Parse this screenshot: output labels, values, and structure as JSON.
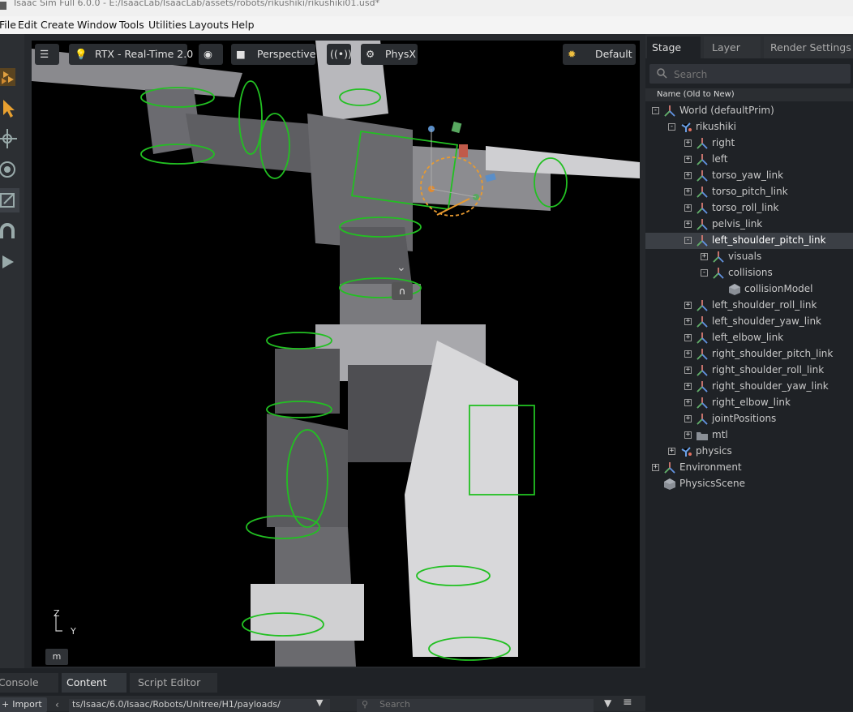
{
  "window": {
    "title": "Isaac Sim Full 6.0.0 - E:/IsaacLab/IsaacLab/assets/robots/rikushiki/rikushiki01.usd*"
  },
  "menu": [
    "File",
    "Edit",
    "Create",
    "Window",
    "Tools",
    "Utilities",
    "Layouts",
    "Help"
  ],
  "viewport": {
    "toolbar": {
      "renderer": "RTX - Real-Time 2.0",
      "camera": "Perspective",
      "physics": "PhysX",
      "lighting": "Default"
    },
    "axis": {
      "z": "Z",
      "y": "Y"
    },
    "units_button": "m"
  },
  "stage_panel": {
    "tabs": [
      "Stage",
      "Layer",
      "Render Settings"
    ],
    "search_placeholder": "Search",
    "column_header": "Name (Old to New)",
    "tree": [
      {
        "label": "World (defaultPrim)",
        "depth": 0,
        "expander": "-",
        "icon": "xform-icon"
      },
      {
        "label": "rikushiki",
        "depth": 1,
        "expander": "-",
        "icon": "articulation-icon"
      },
      {
        "label": "right",
        "depth": 2,
        "expander": "+",
        "icon": "xform-icon"
      },
      {
        "label": "left",
        "depth": 2,
        "expander": "+",
        "icon": "xform-icon"
      },
      {
        "label": "torso_yaw_link",
        "depth": 2,
        "expander": "+",
        "icon": "xform-icon"
      },
      {
        "label": "torso_pitch_link",
        "depth": 2,
        "expander": "+",
        "icon": "xform-icon"
      },
      {
        "label": "torso_roll_link",
        "depth": 2,
        "expander": "+",
        "icon": "xform-icon"
      },
      {
        "label": "pelvis_link",
        "depth": 2,
        "expander": "+",
        "icon": "xform-icon"
      },
      {
        "label": "left_shoulder_pitch_link",
        "depth": 2,
        "expander": "-",
        "icon": "xform-icon",
        "selected": true
      },
      {
        "label": "visuals",
        "depth": 3,
        "expander": "+",
        "icon": "xform-icon"
      },
      {
        "label": "collisions",
        "depth": 3,
        "expander": "-",
        "icon": "xform-icon"
      },
      {
        "label": "collisionModel",
        "depth": 4,
        "expander": "",
        "icon": "mesh-icon"
      },
      {
        "label": "left_shoulder_roll_link",
        "depth": 2,
        "expander": "+",
        "icon": "xform-icon"
      },
      {
        "label": "left_shoulder_yaw_link",
        "depth": 2,
        "expander": "+",
        "icon": "xform-icon"
      },
      {
        "label": "left_elbow_link",
        "depth": 2,
        "expander": "+",
        "icon": "xform-icon"
      },
      {
        "label": "right_shoulder_pitch_link",
        "depth": 2,
        "expander": "+",
        "icon": "xform-icon"
      },
      {
        "label": "right_shoulder_roll_link",
        "depth": 2,
        "expander": "+",
        "icon": "xform-icon"
      },
      {
        "label": "right_shoulder_yaw_link",
        "depth": 2,
        "expander": "+",
        "icon": "xform-icon"
      },
      {
        "label": "right_elbow_link",
        "depth": 2,
        "expander": "+",
        "icon": "xform-icon"
      },
      {
        "label": "jointPositions",
        "depth": 2,
        "expander": "+",
        "icon": "xform-icon"
      },
      {
        "label": "mtl",
        "depth": 2,
        "expander": "+",
        "icon": "folder-icon"
      },
      {
        "label": "physics",
        "depth": 1,
        "expander": "+",
        "icon": "articulation-icon"
      },
      {
        "label": "Environment",
        "depth": 0,
        "expander": "+",
        "icon": "xform-icon"
      },
      {
        "label": "PhysicsScene",
        "depth": 0,
        "expander": "",
        "icon": "mesh-icon"
      }
    ]
  },
  "bottom_panel": {
    "tabs": [
      "Console",
      "Content",
      "Script Editor"
    ],
    "import_label": "Import",
    "path": "ts/Isaac/6.0/Isaac/Robots/Unitree/H1/payloads/",
    "search_placeholder": "Search"
  },
  "colors": {
    "accent_collision": "#22c022",
    "selection": "#3b3f45",
    "panel_bg": "#1f2226"
  }
}
